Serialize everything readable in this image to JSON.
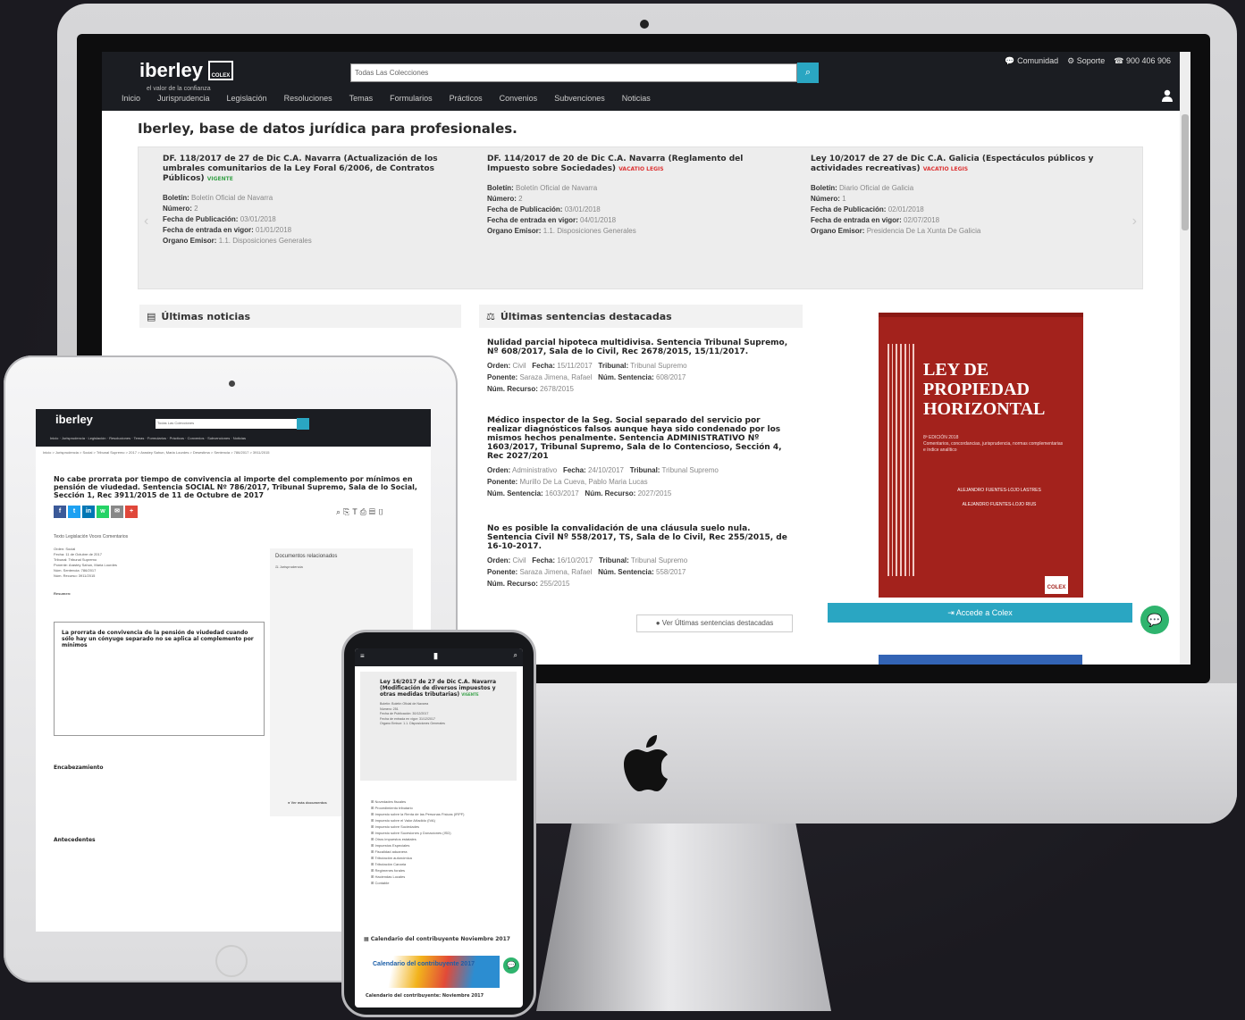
{
  "site": {
    "logo": "iberley",
    "logo_tagline": "el valor de la confianza",
    "publisher_badge": "COLEX",
    "search_placeholder": "Todas Las Colecciones",
    "top_links": [
      "Comunidad",
      "Soporte",
      "900 406 906"
    ],
    "nav": [
      "Inicio",
      "Jurisprudencia",
      "Legislación",
      "Resoluciones",
      "Temas",
      "Formularios",
      "Prácticos",
      "Convenios",
      "Subvenciones",
      "Noticias"
    ]
  },
  "page_title": "Iberley, base de datos jurídica para profesionales.",
  "carousel": [
    {
      "title": "DF. 118/2017 de 27 de Dic C.A. Navarra (Actualización de los umbrales comunitarios de la Ley Foral 6/2006, de Contratos Públicos)",
      "tag": "VIGENTE",
      "boletin": "Boletín Oficial de Navarra",
      "numero": "2",
      "fecha_pub": "03/01/2018",
      "fecha_vigor": "01/01/2018",
      "organo": "1.1. Disposiciones Generales"
    },
    {
      "title": "DF. 114/2017 de 20 de Dic C.A. Navarra (Reglamento del Impuesto sobre Sociedades)",
      "tag": "VACATIO LEGIS",
      "boletin": "Boletín Oficial de Navarra",
      "numero": "2",
      "fecha_pub": "03/01/2018",
      "fecha_vigor": "04/01/2018",
      "organo": "1.1. Disposiciones Generales"
    },
    {
      "title": "Ley 10/2017 de 27 de Dic C.A. Galicia (Espectáculos públicos y actividades recreativas)",
      "tag": "VACATIO LEGIS",
      "boletin": "Diario Oficial de Galicia",
      "numero": "1",
      "fecha_pub": "02/01/2018",
      "fecha_vigor": "02/07/2018",
      "organo": "Presidencia De La Xunta De Galicia"
    }
  ],
  "labels": {
    "boletin": "Boletín:",
    "numero": "Número:",
    "fecha_pub": "Fecha de Publicación:",
    "fecha_vigor": "Fecha de entrada en vigor:",
    "organo": "Organo Emisor:",
    "orden": "Orden:",
    "fecha": "Fecha:",
    "tribunal": "Tribunal:",
    "ponente": "Ponente:",
    "num_sentencia": "Núm. Sentencia:",
    "num_recurso": "Núm. Recurso:"
  },
  "sections": {
    "news": "Últimas noticias",
    "rulings": "Últimas sentencias destacadas"
  },
  "rulings": [
    {
      "title": "Nulidad parcial hipoteca multidivisa. Sentencia Tribunal Supremo, Nº 608/2017, Sala de lo Civil, Rec 2678/2015, 15/11/2017.",
      "orden": "Civil",
      "fecha": "15/11/2017",
      "tribunal": "Tribunal Supremo",
      "ponente": "Saraza Jimena, Rafael",
      "num_sentencia": "608/2017",
      "num_recurso": "2678/2015"
    },
    {
      "title": "Médico inspector de la Seg. Social separado del servicio por realizar diagnósticos falsos aunque haya sido condenado por los mismos hechos penalmente. Sentencia ADMINISTRATIVO Nº 1603/2017, Tribunal Supremo, Sala de lo Contencioso, Sección 4, Rec 2027/201",
      "orden": "Administrativo",
      "fecha": "24/10/2017",
      "tribunal": "Tribunal Supremo",
      "ponente": "Murillo De La Cueva, Pablo Maria Lucas",
      "num_sentencia": "1603/2017",
      "num_recurso": "2027/2015"
    },
    {
      "title": "No es posible la convalidación de una cláusula suelo nula. Sentencia Civil Nº 558/2017, TS, Sala de lo Civil, Rec 255/2015, de 16-10-2017.",
      "orden": "Civil",
      "fecha": "16/10/2017",
      "tribunal": "Tribunal Supremo",
      "ponente": "Saraza Jimena, Rafael",
      "num_sentencia": "558/2017",
      "num_recurso": "255/2015"
    }
  ],
  "more_rulings": "Ver Últimas sentencias destacadas",
  "book": {
    "title_lines": [
      "LEY DE",
      "PROPIEDAD",
      "HORIZONTAL"
    ],
    "edition": "8ª EDICIÓN 2018",
    "subtitle": "Comentarios, concordancias, jurisprudencia, normas complementarias e índice analítico",
    "authors": [
      "ALEJANDRO FUENTES-LOJO LASTRES",
      "ALEJANDRO FUENTES-LOJO RIUS"
    ]
  },
  "cta": "Accede a Colex",
  "tablet": {
    "breadcrumb": "Inicio > Jurisprudencia > Social > Tribunal Supremo > 2017 > Arastey Sahun, Maria Lourdes > Desestima > Sentencia > 786/2017 > 3911/2015",
    "title": "No cabe prorrata por tiempo de convivencia al importe del complemento por mínimos en pensión de viudedad. Sentencia SOCIAL Nº 786/2017, Tribunal Supremo, Sala de lo Social, Sección 1, Rec 3911/2015 de 11 de Octubre de 2017",
    "tabs": "Texto   Legislación   Voces   Comentarios",
    "meta": [
      "Orden: Social",
      "Fecha: 11 de Octubre de 2017",
      "Tribunal: Tribunal Supremo",
      "Ponente: Arastey Sahun, Maria Lourdes",
      "Núm. Sentencia: 786/2017",
      "Núm. Recurso: 3911/2015"
    ],
    "summary_label": "Resumen:",
    "summary_title": "La prorrata de convivencia de la pensión de viudedad cuando sólo hay un cónyuge separado no se aplica al complemento por mínimos",
    "related": "Documentos relacionados",
    "related_tab": "Jurisprudencia",
    "h_encabezamiento": "Encabezamiento",
    "h_antecedentes": "Antecedentes",
    "more_docs": "Ver más documentos"
  },
  "phone": {
    "card_title": "Ley 16/2017 de 27 de Dic C.A. Navarra (Modificación de diversos impuestos y otras medidas tributarias)",
    "card_tag": "VIGENTE",
    "card_meta": [
      "Boletín: Boletín Oficial de Navarra",
      "Número: 251",
      "Fecha de Publicación: 30/12/2017",
      "Fecha de entrada en vigor: 31/12/2017",
      "Organo Emisor: 1.1. Disposiciones Generales"
    ],
    "list": [
      "Novedades fiscales",
      "Procedimiento tributario",
      "Impuesto sobre la Renta de las Personas Físicas (IRPF)",
      "Impuesto sobre el Valor Añadido (IVA)",
      "Impuesto sobre Sociedades",
      "Impuesto sobre Sucesiones y Donaciones (ISD)",
      "Otros impuestos estatales",
      "Impuestos Especiales",
      "Fiscalidad aduanera",
      "Tributación autonómica",
      "Tributación Canaria",
      "Regímenes forales",
      "Haciendas Locales",
      "Contable"
    ],
    "calendar_heading": "Calendario del contribuyente Noviembre 2017",
    "calendar_img_text": "Calendario del contribuyente 2017",
    "calendar_caption": "Calendario del contribuyente: Noviembre 2017"
  }
}
